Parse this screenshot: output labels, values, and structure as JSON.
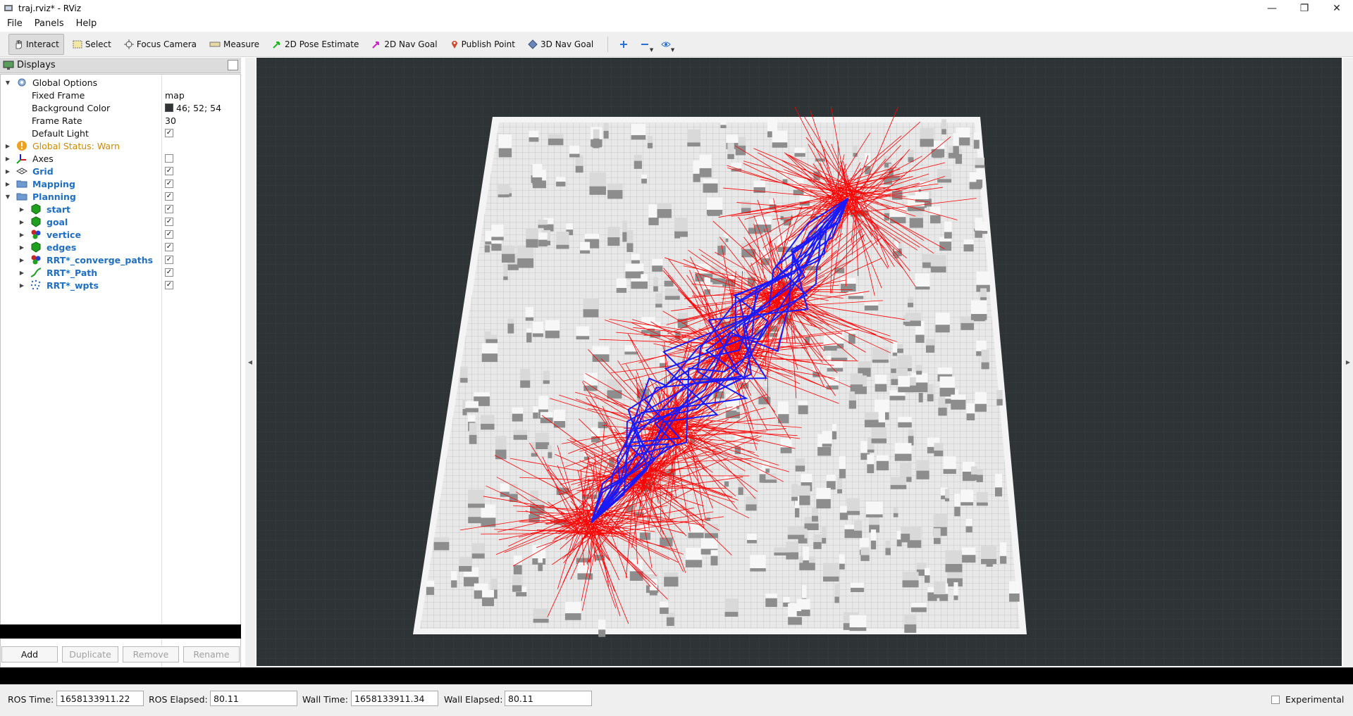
{
  "window": {
    "title": "traj.rviz* - RViz",
    "minimize": "—",
    "maximize": "❐",
    "close": "✕"
  },
  "menu": [
    "File",
    "Panels",
    "Help"
  ],
  "toolbar": {
    "interact": "Interact",
    "select": "Select",
    "focus_camera": "Focus Camera",
    "measure": "Measure",
    "pose_estimate": "2D Pose Estimate",
    "nav_goal": "2D Nav Goal",
    "publish_point": "Publish Point",
    "nav_goal_3d": "3D Nav Goal"
  },
  "displays": {
    "title": "Displays",
    "global_options": {
      "label": "Global Options",
      "fixed_frame_label": "Fixed Frame",
      "fixed_frame_value": "map",
      "background_color_label": "Background Color",
      "background_color_value": "46; 52; 54",
      "background_color_hex": "#2e3436",
      "frame_rate_label": "Frame Rate",
      "frame_rate_value": "30",
      "default_light_label": "Default Light",
      "default_light_checked": true
    },
    "global_status": "Global Status: Warn",
    "items": [
      {
        "label": "Axes",
        "checked": false
      },
      {
        "label": "Grid",
        "checked": true
      },
      {
        "label": "Mapping",
        "checked": true
      },
      {
        "label": "Planning",
        "checked": true
      }
    ],
    "planning_children": [
      {
        "label": "start",
        "checked": true
      },
      {
        "label": "goal",
        "checked": true
      },
      {
        "label": "vertice",
        "checked": true
      },
      {
        "label": "edges",
        "checked": true
      },
      {
        "label": "RRT*_converge_paths",
        "checked": true
      },
      {
        "label": "RRT*_Path",
        "checked": true
      },
      {
        "label": "RRT*_wpts",
        "checked": true
      }
    ],
    "buttons": {
      "add": "Add",
      "duplicate": "Duplicate",
      "remove": "Remove",
      "rename": "Rename"
    }
  },
  "status": {
    "ros_time_label": "ROS Time:",
    "ros_time": "1658133911.22",
    "ros_elapsed_label": "ROS Elapsed:",
    "ros_elapsed": "80.11",
    "wall_time_label": "Wall Time:",
    "wall_time": "1658133911.34",
    "wall_elapsed_label": "Wall Elapsed:",
    "wall_elapsed": "80.11",
    "experimental": "Experimental"
  },
  "colors": {
    "edges": "#ff0000",
    "converge_paths": "#1a1aff",
    "map_floor": "#e6e6e6",
    "background": "#2e3436",
    "warn": "#d08800"
  }
}
